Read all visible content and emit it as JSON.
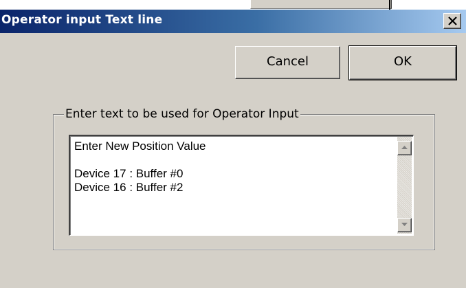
{
  "window": {
    "title": "Operator input Text line",
    "close_icon": "close-icon"
  },
  "buttons": {
    "cancel_label": "Cancel",
    "ok_label": "OK"
  },
  "group": {
    "label": "Enter text to be used for Operator Input"
  },
  "textarea": {
    "lines": [
      "Enter New Position Value",
      "",
      "Device 17 : Buffer #0",
      "Device 16 : Buffer #2"
    ]
  },
  "scrollbar": {
    "up_icon": "scroll-up-arrow-icon",
    "down_icon": "scroll-down-arrow-icon"
  }
}
